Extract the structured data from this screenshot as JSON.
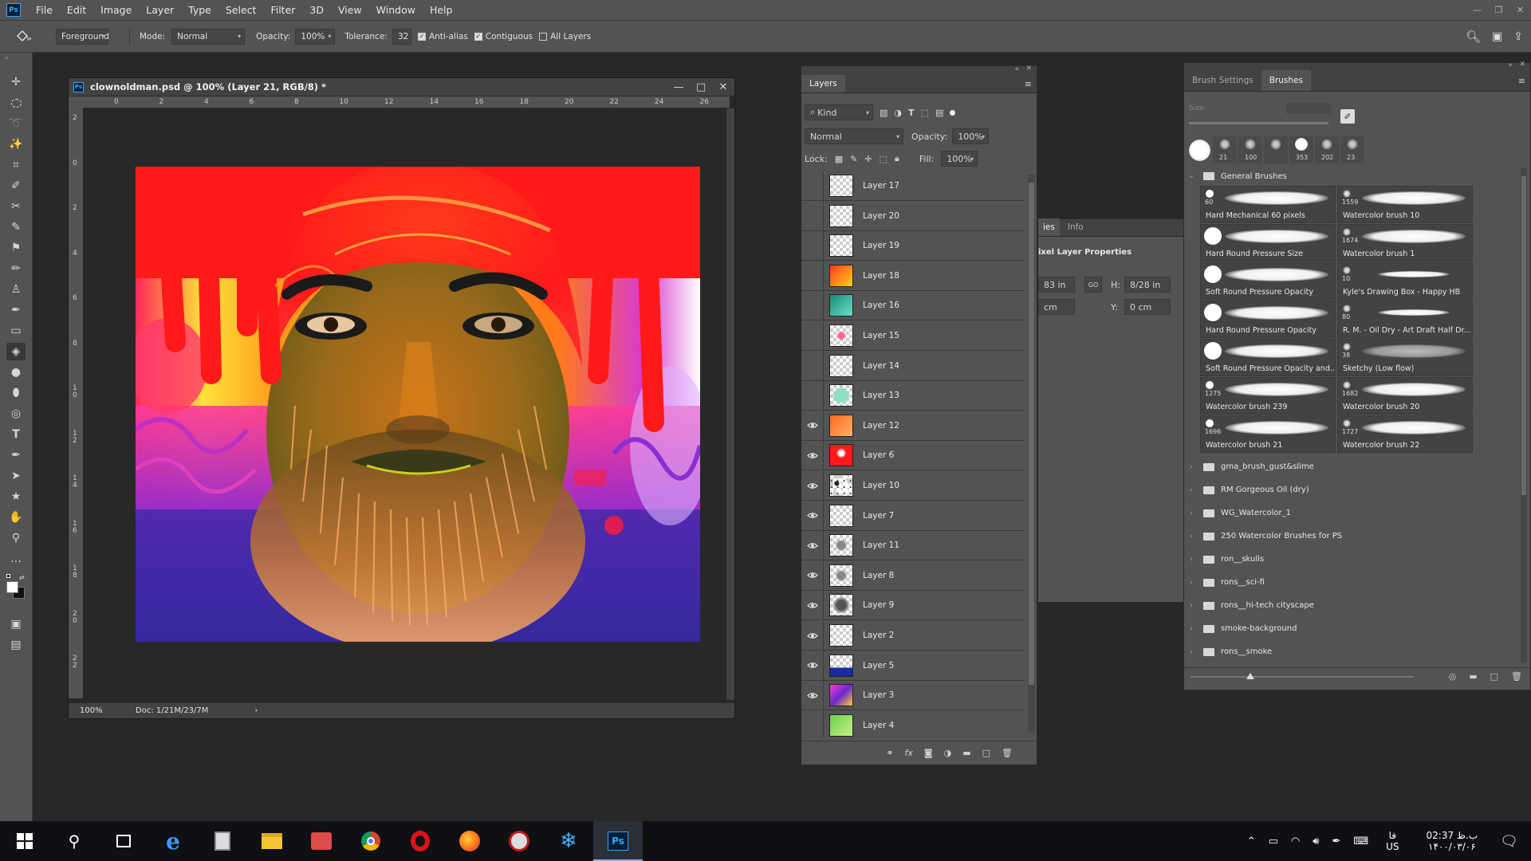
{
  "app": {
    "logo": "Ps"
  },
  "menu": [
    "File",
    "Edit",
    "Image",
    "Layer",
    "Type",
    "Select",
    "Filter",
    "3D",
    "View",
    "Window",
    "Help"
  ],
  "options": {
    "source": "Foreground",
    "mode_label": "Mode:",
    "mode_value": "Normal",
    "opacity_label": "Opacity:",
    "opacity_value": "100%",
    "tolerance_label": "Tolerance:",
    "tolerance_value": "32",
    "antialias_label": "Anti-alias",
    "contiguous_label": "Contiguous",
    "all_layers_label": "All Layers",
    "antialias_checked": true,
    "contiguous_checked": true,
    "all_layers_checked": false
  },
  "document": {
    "title": "clownoldman.psd @ 100% (Layer 21, RGB/8) *",
    "zoom": "100%",
    "doc_info": "Doc: 1/21M/23/7M",
    "ruler_h": [
      "0",
      "2",
      "4",
      "6",
      "8",
      "10",
      "12",
      "14",
      "16",
      "18",
      "20",
      "22",
      "24",
      "26"
    ],
    "ruler_v": [
      "2",
      "0",
      "2",
      "4",
      "6",
      "8",
      "1\n0",
      "1\n2",
      "1\n4",
      "1\n6",
      "1\n8",
      "2\n0",
      "2\n2"
    ]
  },
  "layers_panel": {
    "tab": "Layers",
    "filter_kind": "Kind",
    "blend_mode": "Normal",
    "opacity_label": "Opacity:",
    "opacity_value": "100%",
    "lock_label": "Lock:",
    "fill_label": "Fill:",
    "fill_value": "100%",
    "layers": [
      {
        "name": "Layer 17",
        "visible": false,
        "thumb": "empty"
      },
      {
        "name": "Layer 20",
        "visible": false,
        "thumb": "empty"
      },
      {
        "name": "Layer 19",
        "visible": false,
        "thumb": "empty"
      },
      {
        "name": "Layer 18",
        "visible": false,
        "thumb": "warm"
      },
      {
        "name": "Layer 16",
        "visible": false,
        "thumb": "teal"
      },
      {
        "name": "Layer 15",
        "visible": false,
        "thumb": "pink"
      },
      {
        "name": "Layer 14",
        "visible": false,
        "thumb": "empty"
      },
      {
        "name": "Layer 13",
        "visible": false,
        "thumb": "mint"
      },
      {
        "name": "Layer 12",
        "visible": true,
        "thumb": "orange"
      },
      {
        "name": "Layer 6",
        "visible": true,
        "thumb": "red"
      },
      {
        "name": "Layer 10",
        "visible": true,
        "thumb": "eyes"
      },
      {
        "name": "Layer 7",
        "visible": true,
        "thumb": "empty"
      },
      {
        "name": "Layer 11",
        "visible": true,
        "thumb": "sketch"
      },
      {
        "name": "Layer 8",
        "visible": true,
        "thumb": "sketch"
      },
      {
        "name": "Layer 9",
        "visible": true,
        "thumb": "face"
      },
      {
        "name": "Layer 2",
        "visible": true,
        "thumb": "empty"
      },
      {
        "name": "Layer 5",
        "visible": true,
        "thumb": "blue"
      },
      {
        "name": "Layer 3",
        "visible": true,
        "thumb": "purple"
      },
      {
        "name": "Layer 4",
        "visible": false,
        "thumb": "green"
      }
    ]
  },
  "properties_panel": {
    "tab1": "ies",
    "tab2": "Info",
    "title": "ixel Layer Properties",
    "w_value": "83 in",
    "h_label": "H:",
    "h_value": "8/28 in",
    "x_value": "cm",
    "y_label": "Y:",
    "y_value": "0 cm",
    "link_label": "GO"
  },
  "brushes_panel": {
    "tab_settings": "Brush Settings",
    "tab_brushes": "Brushes",
    "size_label": "Size:",
    "recent_sizes": [
      "",
      "21",
      "100",
      "",
      "353",
      "202",
      "23"
    ],
    "group_name": "General Brushes",
    "brushes": [
      {
        "num": "60",
        "name": "Hard Mechanical 60 pixels"
      },
      {
        "num": "1559",
        "name": "Watercolor brush 10"
      },
      {
        "num": "",
        "name": "Hard Round Pressure Size"
      },
      {
        "num": "1674",
        "name": "Watercolor brush 1"
      },
      {
        "num": "",
        "name": "Soft Round Pressure Opacity"
      },
      {
        "num": "10",
        "name": "Kyle's Drawing Box - Happy HB"
      },
      {
        "num": "",
        "name": "Hard Round Pressure Opacity"
      },
      {
        "num": "80",
        "name": "R. M. - Oil Dry - Art Draft Half Dr..."
      },
      {
        "num": "",
        "name": "Soft Round Pressure Opacity and..."
      },
      {
        "num": "38",
        "name": "Sketchy (Low flow)"
      },
      {
        "num": "1275",
        "name": "Watercolor brush 239"
      },
      {
        "num": "1682",
        "name": "Watercolor brush 20"
      },
      {
        "num": "1696",
        "name": "Watercolor brush 21"
      },
      {
        "num": "1727",
        "name": "Watercolor brush 22"
      }
    ],
    "folders": [
      "gma_brush_gust&slime",
      "RM Gorgeous Oil (dry)",
      "WG_Watercolor_1",
      "250 Watercolor Brushes for PS",
      "ron__skulls",
      "rons__sci-fi",
      "rons__hi-tech cityscape",
      "smoke-background",
      "rons__smoke"
    ]
  },
  "taskbar": {
    "time": "02:37 ب.ظ",
    "date": "۱۴۰۰/۰۳/۰۶",
    "lang_top": "فا",
    "lang_bottom": "US"
  },
  "colors": {
    "accent": "#31a8ff",
    "panel": "#535353",
    "dark": "#282828"
  }
}
